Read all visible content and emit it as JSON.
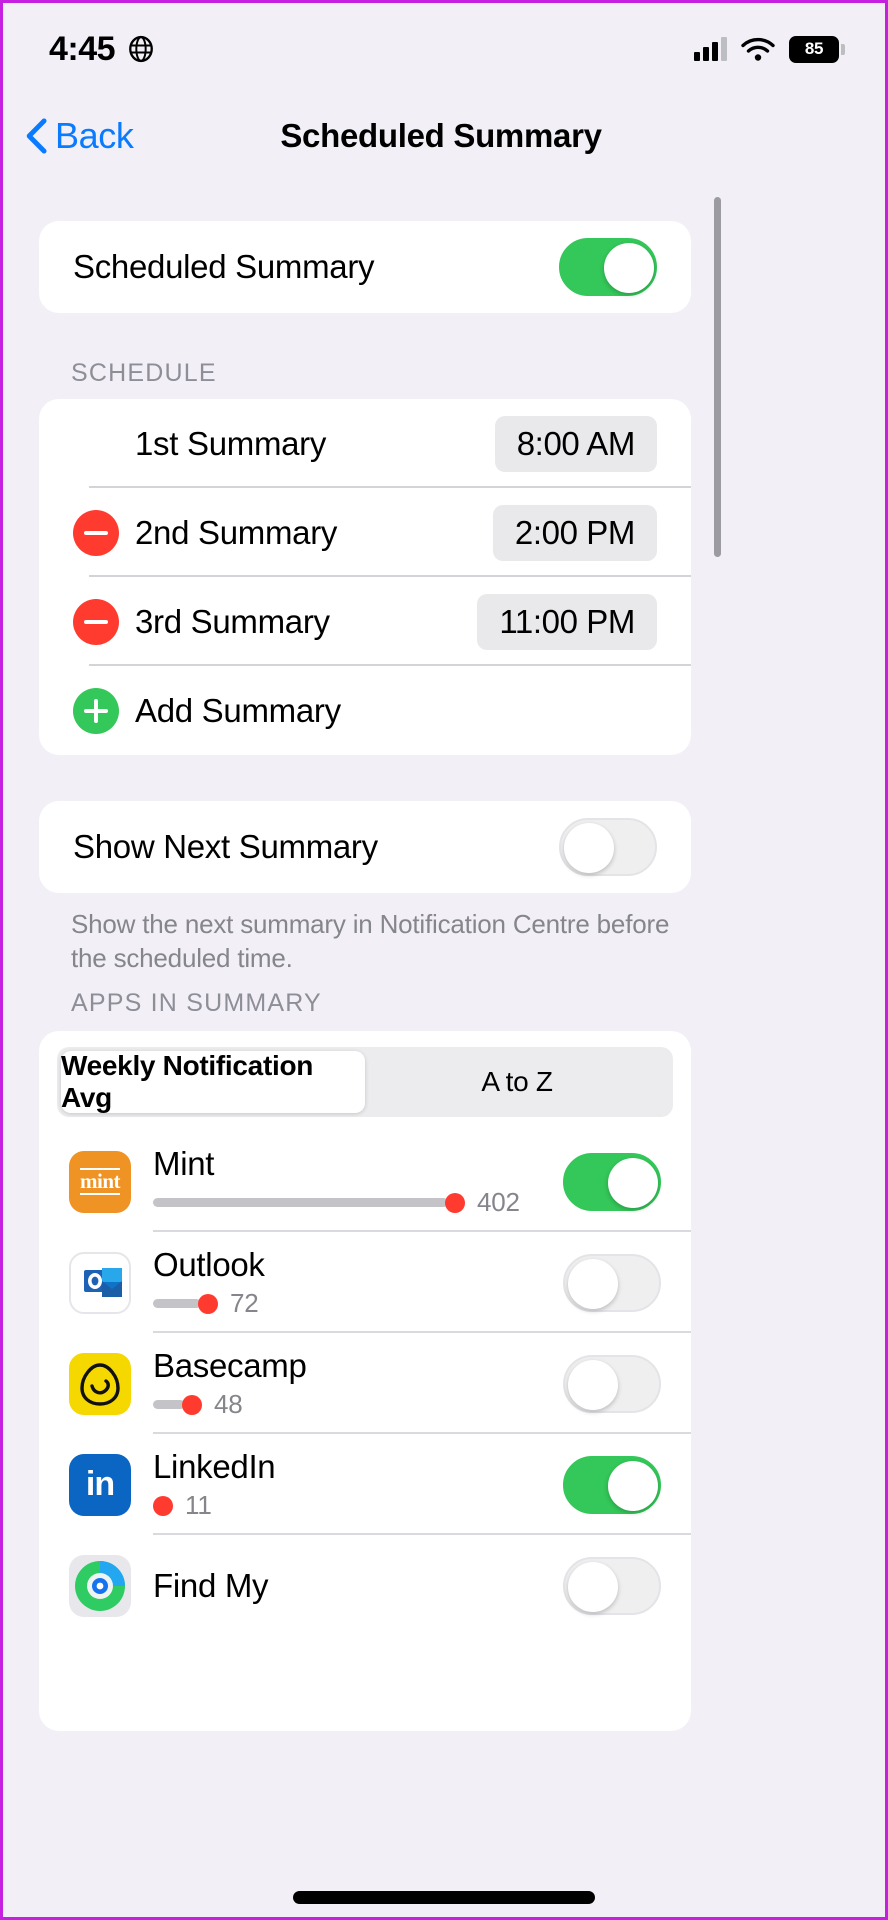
{
  "status_bar": {
    "time": "4:45",
    "globe_icon": "globe-icon",
    "signal_icon": "cellular-signal-icon",
    "wifi_icon": "wifi-icon",
    "battery_percent": "85"
  },
  "nav": {
    "back_label": "Back",
    "back_icon": "chevron-left-icon",
    "title": "Scheduled Summary"
  },
  "main_toggle": {
    "label": "Scheduled Summary",
    "state": "on"
  },
  "schedule": {
    "header": "SCHEDULE",
    "rows": [
      {
        "label": "1st Summary",
        "time": "8:00 AM",
        "action_icon": "none"
      },
      {
        "label": "2nd Summary",
        "time": "2:00 PM",
        "action_icon": "minus-circle-icon"
      },
      {
        "label": "3rd Summary",
        "time": "11:00 PM",
        "action_icon": "minus-circle-icon"
      }
    ],
    "add_label": "Add Summary",
    "add_icon": "plus-circle-icon"
  },
  "show_next": {
    "label": "Show Next Summary",
    "state": "off",
    "footnote": "Show the next summary in Notification Centre before the scheduled time."
  },
  "apps_section": {
    "header": "APPS IN SUMMARY",
    "segments": [
      {
        "label": "Weekly Notification Avg",
        "selected": true
      },
      {
        "label": "A to Z",
        "selected": false
      }
    ],
    "apps": [
      {
        "name": "Mint",
        "icon": "mint-app-icon",
        "count": "402",
        "bar_pct": 100,
        "state": "on"
      },
      {
        "name": "Outlook",
        "icon": "outlook-app-icon",
        "count": "72",
        "bar_pct": 17,
        "state": "off"
      },
      {
        "name": "Basecamp",
        "icon": "basecamp-app-icon",
        "count": "48",
        "bar_pct": 11,
        "state": "off"
      },
      {
        "name": "LinkedIn",
        "icon": "linkedin-app-icon",
        "count": "11",
        "bar_pct": 0,
        "state": "on"
      },
      {
        "name": "Find My",
        "icon": "findmy-app-icon",
        "count": "",
        "bar_pct": 0,
        "state": "off"
      }
    ]
  },
  "colors": {
    "accent_blue": "#0a7aff",
    "toggle_on_green": "#34c759",
    "destructive_red": "#ff3b30",
    "page_background": "#f2f0f6",
    "card_background": "#ffffff",
    "secondary_text": "#8e8e99"
  }
}
